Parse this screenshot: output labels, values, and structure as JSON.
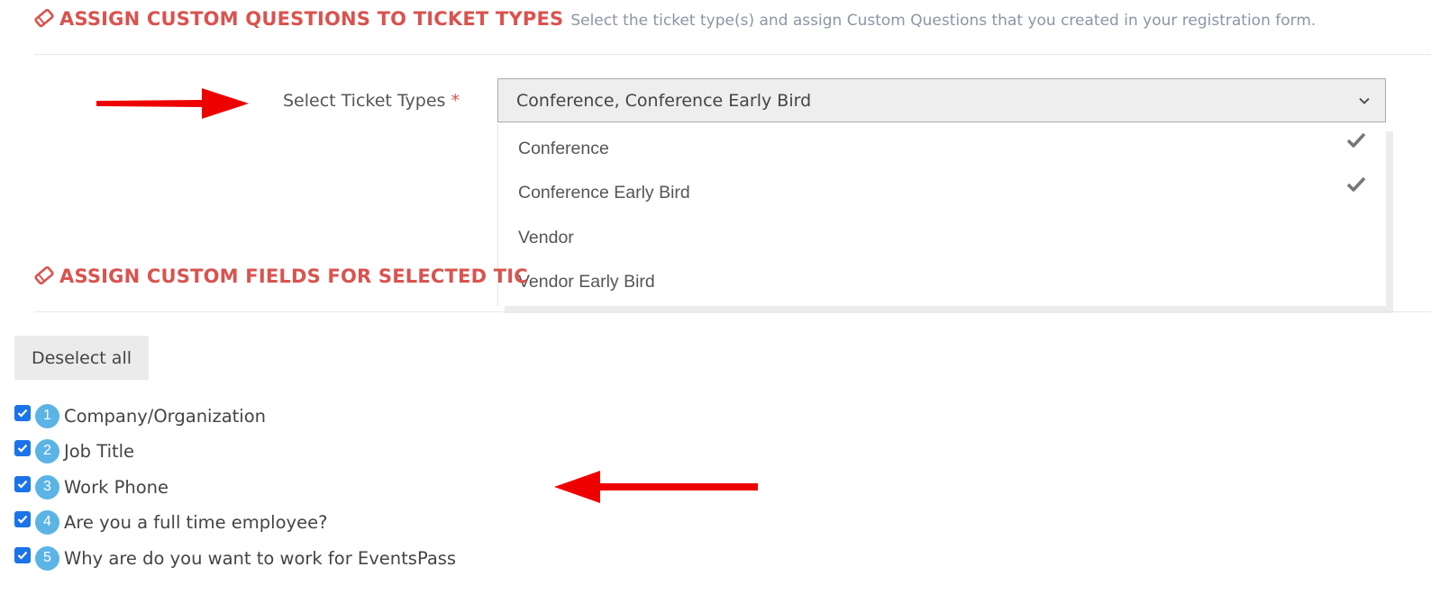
{
  "section1": {
    "title": "ASSIGN CUSTOM QUESTIONS TO TICKET TYPES",
    "subtitle": "Select the ticket type(s) and assign Custom Questions that you created in your registration form."
  },
  "ticket_select": {
    "label": "Select Ticket Types",
    "required_mark": "*",
    "value": "Conference, Conference Early Bird",
    "options": [
      {
        "label": "Conference",
        "selected": true
      },
      {
        "label": "Conference Early Bird",
        "selected": true
      },
      {
        "label": "Vendor",
        "selected": false
      },
      {
        "label": "Vendor Early Bird",
        "selected": false
      }
    ]
  },
  "section2": {
    "title": "ASSIGN CUSTOM FIELDS FOR SELECTED TIC"
  },
  "deselect_label": "Deselect all",
  "questions": [
    {
      "num": "1",
      "label": "Company/Organization",
      "checked": true
    },
    {
      "num": "2",
      "label": "Job Title",
      "checked": true
    },
    {
      "num": "3",
      "label": "Work Phone",
      "checked": true
    },
    {
      "num": "4",
      "label": "Are you a full time employee?",
      "checked": true
    },
    {
      "num": "5",
      "label": "Why are do you want to work for EventsPass",
      "checked": true
    }
  ],
  "colors": {
    "accent_red": "#d9534f",
    "subtitle_gray": "#8a96a3",
    "badge_blue": "#5bb4e5",
    "checkbox_blue": "#1a73e8",
    "arrow_red": "#ee0000"
  },
  "icons": {
    "section_icon": "ticket-tag-icon",
    "select_toggle": "chevron-down-icon",
    "option_selected": "checkmark-icon",
    "annotation": "red-arrow-icon"
  }
}
